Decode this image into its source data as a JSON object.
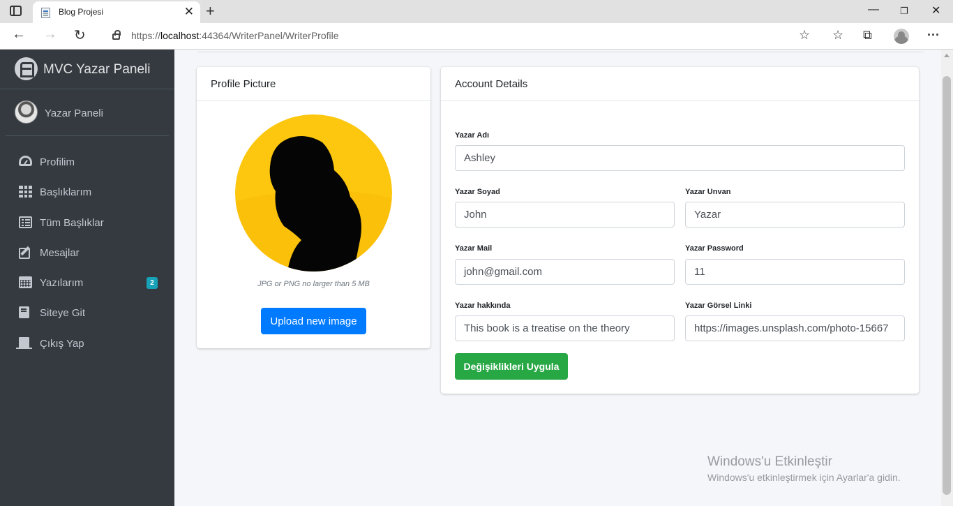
{
  "browser": {
    "tab_title": "Blog Projesi",
    "url_prefix": "https://",
    "url_host": "localhost",
    "url_path": ":44364/WriterPanel/WriterProfile"
  },
  "sidebar": {
    "brand": "MVC Yazar Paneli",
    "user": "Yazar Paneli",
    "items": [
      {
        "label": "Profilim",
        "icon": "tachometer-icon"
      },
      {
        "label": "Başlıklarım",
        "icon": "grid-icon"
      },
      {
        "label": "Tüm Başlıklar",
        "icon": "list-icon"
      },
      {
        "label": "Mesajlar",
        "icon": "edit-icon"
      },
      {
        "label": "Yazılarım",
        "icon": "calendar-icon",
        "badge": "2"
      },
      {
        "label": "Siteye Git",
        "icon": "book-icon"
      },
      {
        "label": "Çıkış Yap",
        "icon": "door-icon"
      }
    ]
  },
  "profile_card": {
    "title": "Profile Picture",
    "hint": "JPG or PNG no larger than 5 MB",
    "button": "Upload new image"
  },
  "account_card": {
    "title": "Account Details",
    "fields": {
      "ad": {
        "label": "Yazar Adı",
        "value": "Ashley"
      },
      "soyad": {
        "label": "Yazar Soyad",
        "value": "John"
      },
      "unvan": {
        "label": "Yazar Unvan",
        "value": "Yazar"
      },
      "mail": {
        "label": "Yazar Mail",
        "value": "john@gmail.com"
      },
      "password": {
        "label": "Yazar Password",
        "value": "11"
      },
      "hakkinda": {
        "label": "Yazar hakkında",
        "value": "This book is a treatise on the theory"
      },
      "gorsel": {
        "label": "Yazar Görsel Linki",
        "value": "https://images.unsplash.com/photo-15667"
      }
    },
    "button": "Değişiklikleri Uygula"
  },
  "watermark": {
    "line1": "Windows'u Etkinleştir",
    "line2": "Windows'u etkinleştirmek için Ayarlar'a gidin."
  },
  "colors": {
    "sidebar": "#343a40",
    "primary": "#007bff",
    "success": "#28a745",
    "badge": "#17a2b8",
    "avatar_bg": "#f9c20f"
  }
}
